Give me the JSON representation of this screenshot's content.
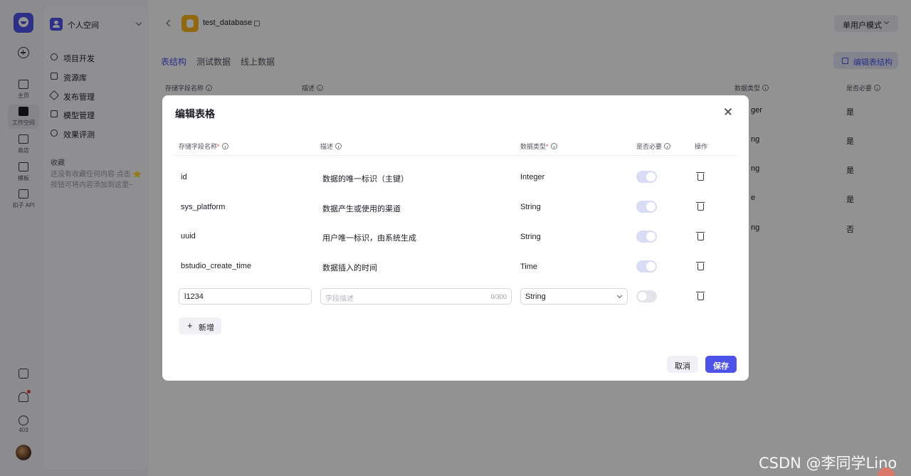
{
  "rail": {
    "items": [
      {
        "label": "主页"
      },
      {
        "label": "工作空间"
      },
      {
        "label": "商店"
      },
      {
        "label": "模板"
      },
      {
        "label": "扣子 API"
      }
    ],
    "badge_count": "403"
  },
  "space": {
    "name": "个人空间",
    "nav": [
      {
        "label": "项目开发"
      },
      {
        "label": "资源库"
      },
      {
        "label": "发布管理"
      },
      {
        "label": "模型管理"
      },
      {
        "label": "效果评测"
      }
    ],
    "favorites_title": "收藏",
    "favorites_hint": "还没有收藏任何内容 点击 ⭐ 按钮可将内容添加到这里~"
  },
  "header": {
    "db_name": "test_database",
    "mode_label": "单用户模式",
    "tabs": [
      {
        "label": "表结构",
        "active": true
      },
      {
        "label": "测试数据",
        "active": false
      },
      {
        "label": "线上数据",
        "active": false
      }
    ],
    "edit_structure_label": "编辑表结构"
  },
  "background_table": {
    "columns": [
      "存储字段名称",
      "描述",
      "数据类型",
      "是否必要"
    ],
    "type_fragments": [
      "ger",
      "ng",
      "ng",
      "e",
      "ng"
    ],
    "required": [
      "是",
      "是",
      "是",
      "是",
      "否"
    ]
  },
  "modal": {
    "title": "编辑表格",
    "columns": {
      "name": "存储字段名称",
      "desc": "描述",
      "type": "数据类型",
      "required": "是否必要",
      "actions": "操作"
    },
    "rows": [
      {
        "name": "id",
        "desc": "数据的唯一标识（主键）",
        "type": "Integer",
        "required": true
      },
      {
        "name": "sys_platform",
        "desc": "数据产生或使用的渠道",
        "type": "String",
        "required": true
      },
      {
        "name": "uuid",
        "desc": "用户唯一标识，由系统生成",
        "type": "String",
        "required": true
      },
      {
        "name": "bstudio_create_time",
        "desc": "数据插入的时间",
        "type": "Time",
        "required": true
      }
    ],
    "new_row": {
      "name_value": "l1234",
      "desc_placeholder": "字段描述",
      "desc_count": "0/300",
      "type_value": "String",
      "required": false
    },
    "add_label": "新增",
    "cancel_label": "取消",
    "save_label": "保存"
  },
  "watermark": "CSDN @李同学Lino",
  "colors": {
    "accent": "#4d53e8",
    "db_icon": "#f6b31a",
    "danger": "#e54545"
  }
}
